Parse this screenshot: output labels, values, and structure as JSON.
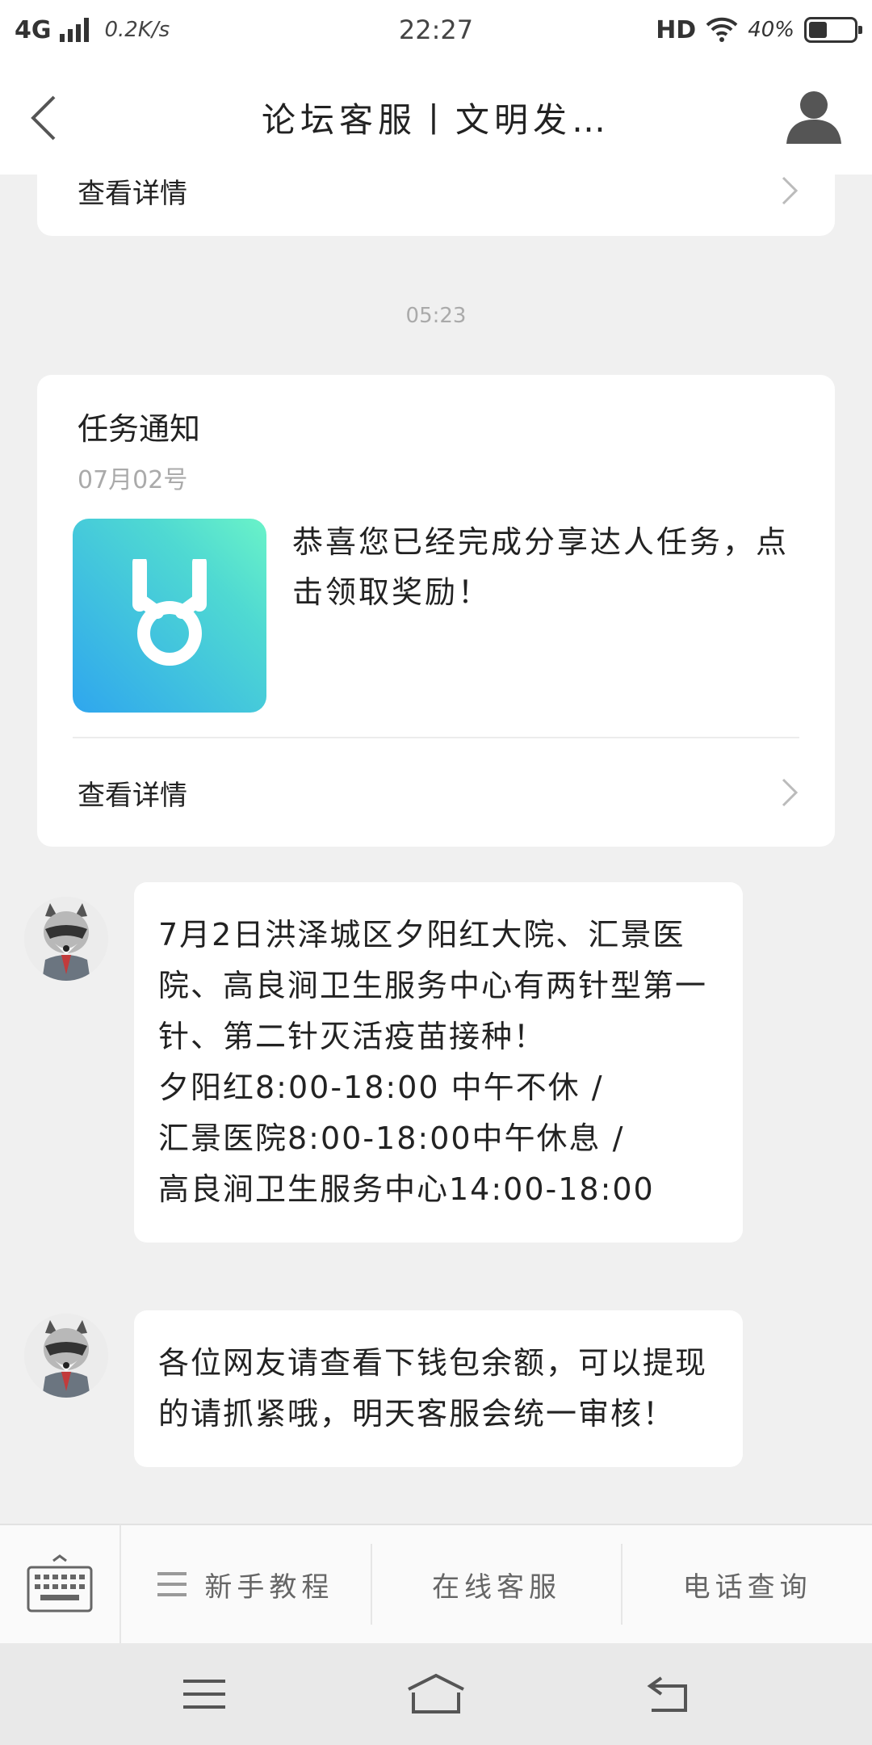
{
  "status_bar": {
    "network": "4G",
    "speed": "0.2K/s",
    "time": "22:27",
    "hd": "HD",
    "battery": "40%",
    "battery_level": 0.4
  },
  "nav": {
    "title": "论坛客服丨文明发…"
  },
  "top_card": {
    "detail_label": "查看详情"
  },
  "timestamp": "05:23",
  "task_card": {
    "title": "任务通知",
    "date": "07月02号",
    "text": "恭喜您已经完成分享达人任务，点击领取奖励！",
    "detail_label": "查看详情"
  },
  "messages": [
    {
      "lines": [
        "7月2日洪泽城区夕阳红大院、汇景医院、高良涧卫生服务中心有两针型第一针、第二针灭活疫苗接种！",
        "夕阳红8:00-18:00 中午不休 /",
        "汇景医院8:00-18:00中午休息 /",
        "高良涧卫生服务中心14:00-18:00"
      ]
    },
    {
      "lines": [
        "各位网友请查看下钱包余额，可以提现的请抓紧哦，明天客服会统一审核！"
      ]
    }
  ],
  "menu": {
    "items": [
      "新手教程",
      "在线客服",
      "电话查询"
    ]
  },
  "icons": {
    "back": "back-chevron-icon",
    "profile": "user-profile-icon",
    "medal": "medal-icon",
    "keyboard": "keyboard-icon",
    "menu": "hamburger-menu-icon"
  },
  "colors": {
    "medal_gradient_start": "#2fa6ee",
    "medal_gradient_end": "#6af3c8",
    "background": "#f0f0f0"
  }
}
